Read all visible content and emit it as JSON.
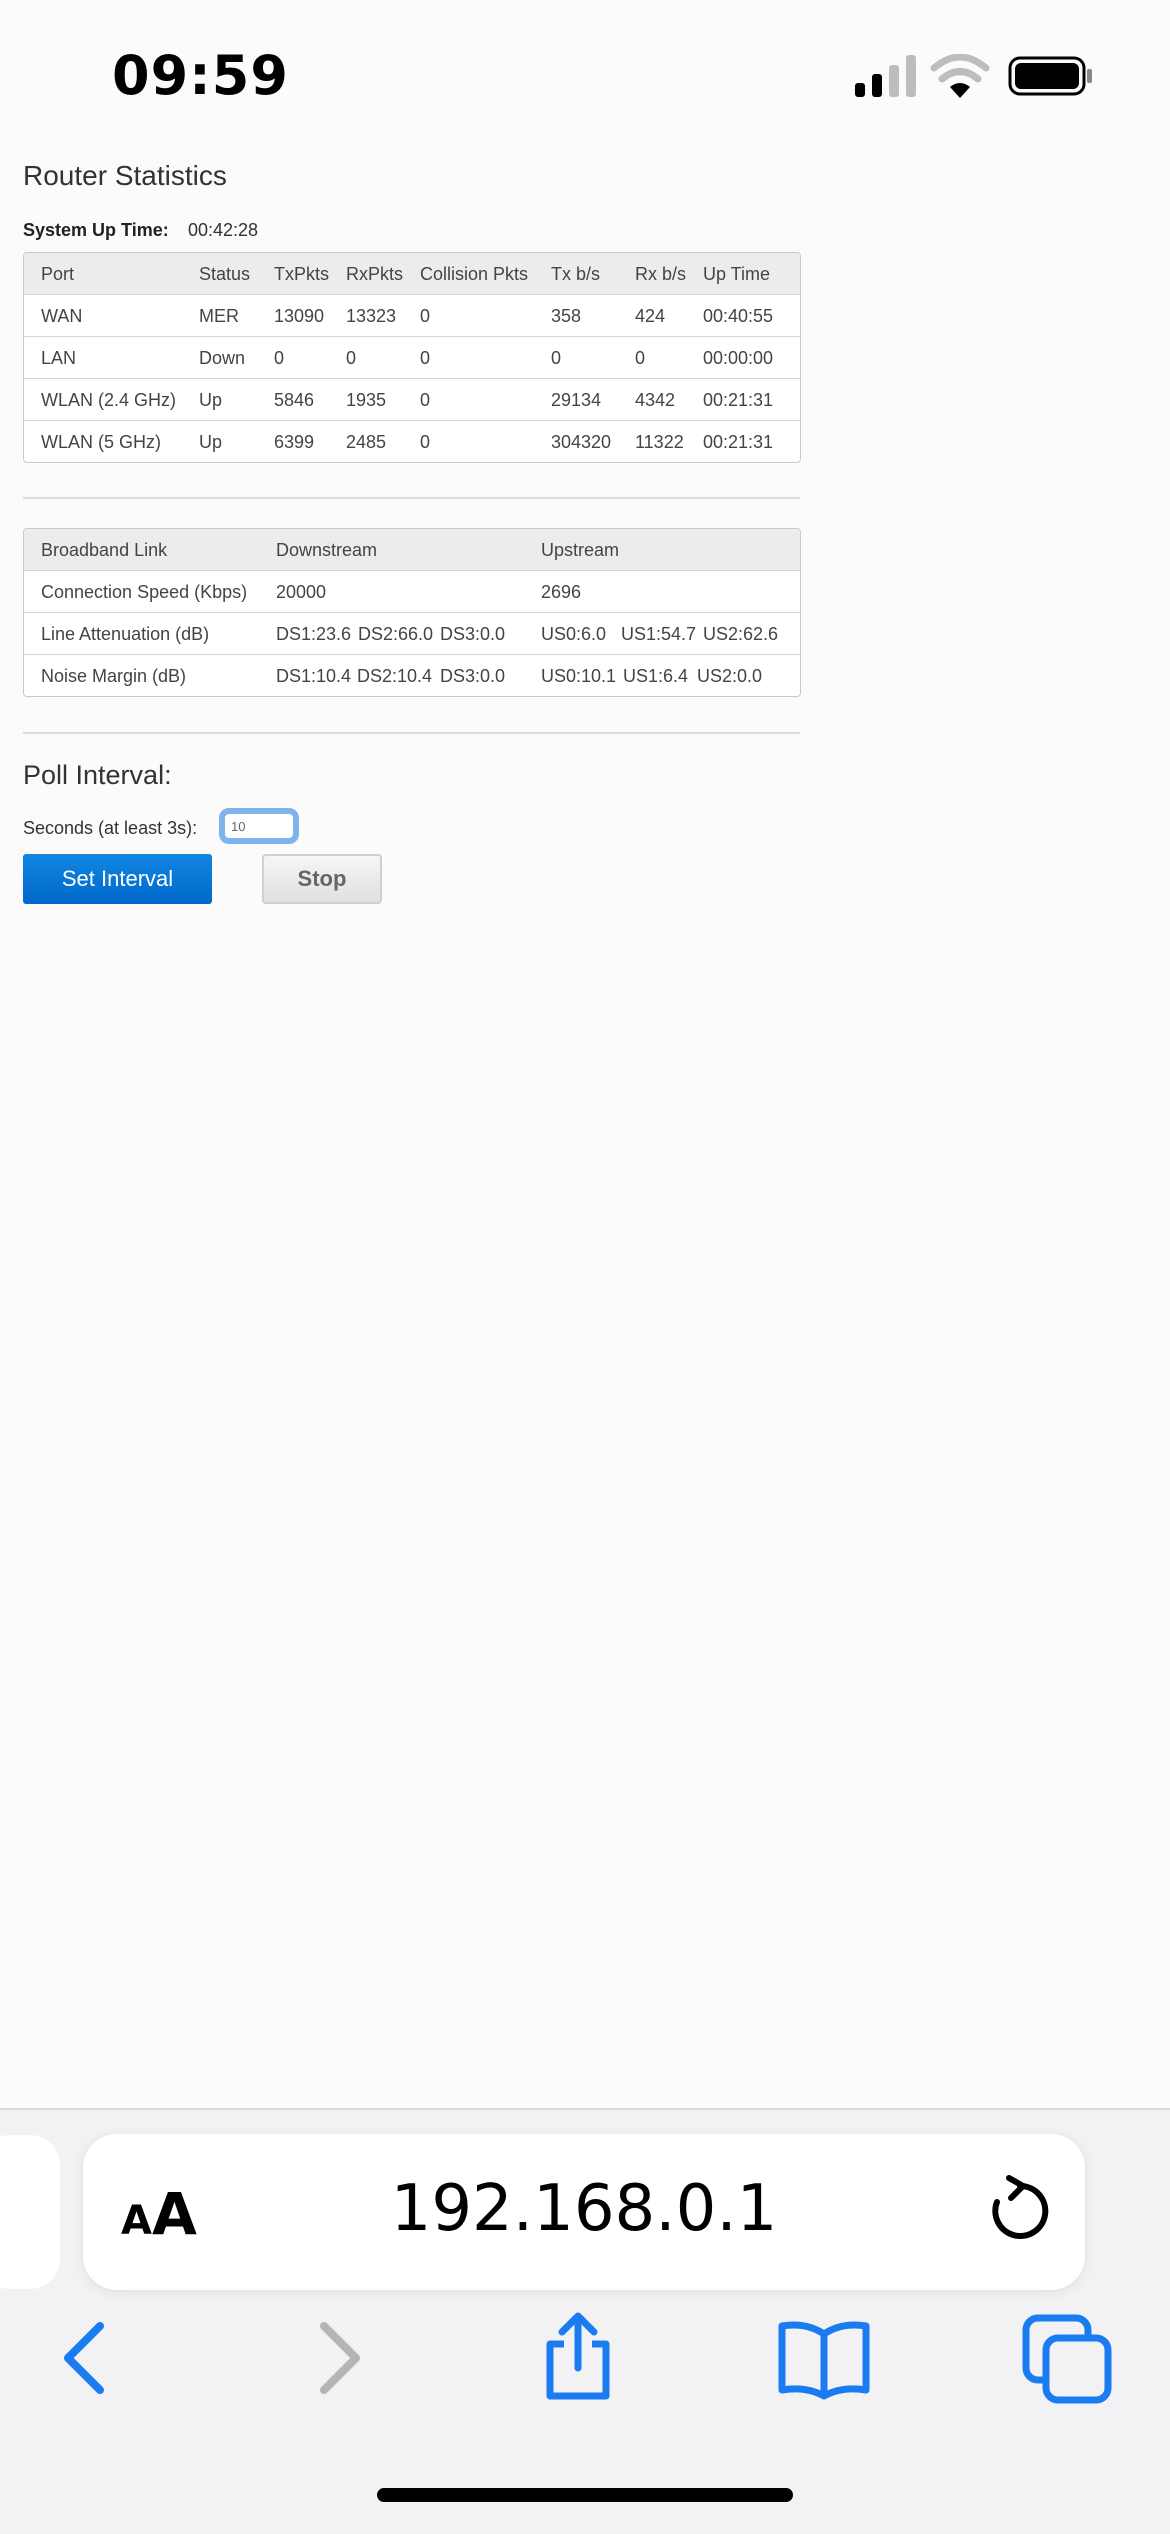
{
  "status_bar": {
    "time": "09:59"
  },
  "page": {
    "title": "Router Statistics",
    "uptime_label": "System Up Time:",
    "uptime_value": "00:42:28"
  },
  "ports_table": {
    "headers": [
      "Port",
      "Status",
      "TxPkts",
      "RxPkts",
      "Collision Pkts",
      "Tx b/s",
      "Rx b/s",
      "Up Time"
    ],
    "rows": [
      [
        "WAN",
        "MER",
        "13090",
        "13323",
        "0",
        "358",
        "424",
        "00:40:55"
      ],
      [
        "LAN",
        "Down",
        "0",
        "0",
        "0",
        "0",
        "0",
        "00:00:00"
      ],
      [
        "WLAN (2.4 GHz)",
        "Up",
        "5846",
        "1935",
        "0",
        "29134",
        "4342",
        "00:21:31"
      ],
      [
        "WLAN (5 GHz)",
        "Up",
        "6399",
        "2485",
        "0",
        "304320",
        "11322",
        "00:21:31"
      ]
    ]
  },
  "broadband_table": {
    "headers": [
      "Broadband Link",
      "Downstream",
      "Upstream"
    ],
    "rows": [
      [
        "Connection Speed (Kbps)",
        "20000",
        "2696"
      ],
      [
        "Line Attenuation (dB)",
        "DS1:23.6",
        "DS2:66.0",
        "DS3:0.0",
        "US0:6.0",
        "US1:54.7",
        "US2:62.6"
      ],
      [
        "Noise Margin (dB)",
        "DS1:10.4",
        "DS2:10.4",
        "DS3:0.0",
        "US0:10.1",
        "US1:6.4",
        "US2:0.0"
      ]
    ]
  },
  "poll": {
    "title": "Poll Interval:",
    "seconds_label": "Seconds (at least 3s):",
    "seconds_value": "10",
    "set_button": "Set Interval",
    "stop_button": "Stop"
  },
  "browser": {
    "aa_small": "A",
    "aa_large": "A",
    "url": "192.168.0.1",
    "accent_color": "#1a7cf0",
    "icons": [
      "back-icon",
      "forward-icon",
      "share-icon",
      "bookmarks-icon",
      "tabs-icon",
      "reload-icon"
    ]
  }
}
